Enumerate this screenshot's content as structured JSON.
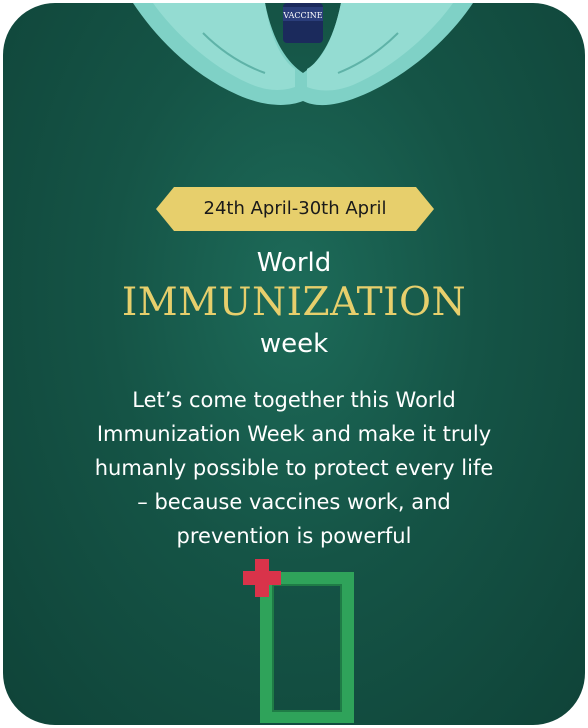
{
  "bottle_label": "VACCINE",
  "date_range": "24th April-30th April",
  "title": {
    "top": "World",
    "main": "IMMUNIZATION",
    "bottom": "week"
  },
  "message_lines": [
    "Let’s come together this World",
    "Immunization Week and make it truly",
    "humanly possible to protect every life",
    "– because vaccines work, and",
    "prevention is powerful"
  ],
  "colors": {
    "background": "#155446",
    "banner": "#e7cf6c",
    "title_accent": "#e7cf6c",
    "cross": "#d9334a",
    "frame": "#2fa35a"
  },
  "icons": [
    "gloved-hands-icon",
    "vaccine-vial-icon",
    "medical-cross-icon",
    "green-frame-icon"
  ]
}
